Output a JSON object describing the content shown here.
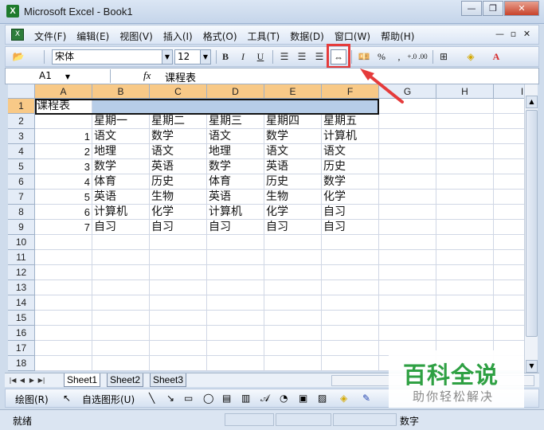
{
  "window": {
    "title": "Microsoft Excel - Book1",
    "app_icon": "X",
    "controls": [
      "minimize-icon",
      "restore-icon",
      "close-icon"
    ]
  },
  "menu": {
    "items": [
      "文件(F)",
      "编辑(E)",
      "视图(V)",
      "插入(I)",
      "格式(O)",
      "工具(T)",
      "数据(D)",
      "窗口(W)",
      "帮助(H)"
    ],
    "mdi_controls": [
      "—",
      "▫",
      "✕"
    ]
  },
  "toolbar": {
    "font": "宋体",
    "size": "12",
    "bold": "B",
    "italic": "I",
    "underline": "U",
    "percent": "%",
    "comma": ",",
    "decimal": "+.0 .00",
    "merge_center_icon": "merge-center-icon"
  },
  "formula_bar": {
    "name_box": "A1",
    "fx": "fx",
    "content": "课程表"
  },
  "columns": [
    "A",
    "B",
    "C",
    "D",
    "E",
    "F",
    "G",
    "H",
    "I"
  ],
  "rows": [
    "1",
    "2",
    "3",
    "4",
    "5",
    "6",
    "7",
    "8",
    "9",
    "10",
    "11",
    "12",
    "13",
    "14",
    "15",
    "16",
    "17",
    "18"
  ],
  "cells": {
    "A1": "课程表",
    "B2": "星期一",
    "C2": "星期二",
    "D2": "星期三",
    "E2": "星期四",
    "F2": "星期五",
    "A3": "1",
    "B3": "语文",
    "C3": "数学",
    "D3": "语文",
    "E3": "数学",
    "F3": "计算机",
    "A4": "2",
    "B4": "地理",
    "C4": "语文",
    "D4": "地理",
    "E4": "语文",
    "F4": "语文",
    "A5": "3",
    "B5": "数学",
    "C5": "英语",
    "D5": "数学",
    "E5": "英语",
    "F5": "历史",
    "A6": "4",
    "B6": "体育",
    "C6": "历史",
    "D6": "体育",
    "E6": "历史",
    "F6": "数学",
    "A7": "5",
    "B7": "英语",
    "C7": "生物",
    "D7": "英语",
    "E7": "生物",
    "F7": "化学",
    "A8": "6",
    "B8": "计算机",
    "C8": "化学",
    "D8": "计算机",
    "E8": "化学",
    "F8": "自习",
    "A9": "7",
    "B9": "自习",
    "C9": "自习",
    "D9": "自习",
    "E9": "自习",
    "F9": "自习"
  },
  "sheet_tabs": [
    "Sheet1",
    "Sheet2",
    "Sheet3"
  ],
  "draw_toolbar": {
    "draw": "绘图(R)",
    "autoshapes": "自选图形(U)"
  },
  "status": {
    "ready": "就绪",
    "mode": "数字"
  },
  "watermark": {
    "main": "百科全说",
    "sub": "助你轻松解决"
  },
  "colors": {
    "selected_header": "#f8c987",
    "selection_fill": "#b7cde8",
    "highlight": "#e53b3b",
    "watermark_green": "#2ea043"
  }
}
